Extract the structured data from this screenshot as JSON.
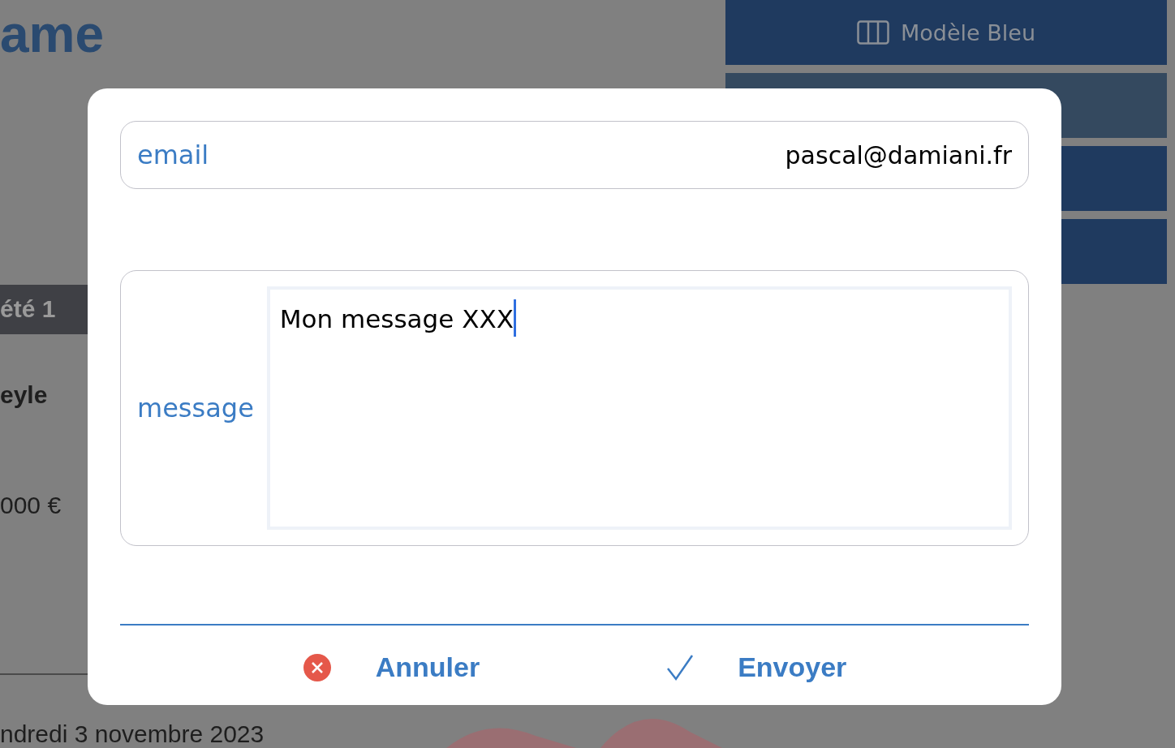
{
  "background": {
    "logo": "ame",
    "template_button": {
      "label": "Modèle Bleu"
    },
    "left_panel": {
      "tab": "été 1",
      "name": "eyle",
      "amount": "000 €",
      "date": "ndredi 3 novembre 2023"
    }
  },
  "dialog": {
    "fields": [
      {
        "kind": "line",
        "label": "email",
        "value": "pascal@damiani.fr",
        "focused": false
      },
      {
        "kind": "area",
        "label": "message",
        "value": "Mon message XXX",
        "focused": true
      }
    ],
    "buttons": [
      {
        "kind": "cancel",
        "label": "Annuler"
      },
      {
        "kind": "confirm",
        "label": "Envoyer"
      }
    ]
  }
}
